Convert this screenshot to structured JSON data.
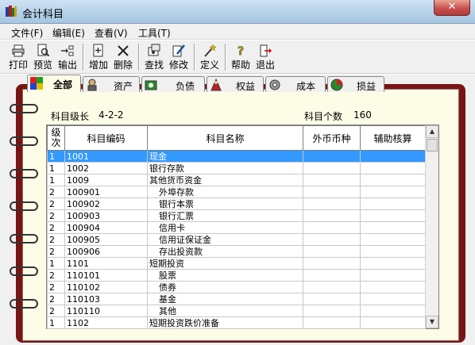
{
  "window": {
    "title": "会计科目",
    "close_label": "✕"
  },
  "menu": [
    "文件(F)",
    "编辑(E)",
    "查看(V)",
    "工具(T)"
  ],
  "toolbar": {
    "print": "打印",
    "preview": "预览",
    "export": "输出",
    "add": "增加",
    "delete": "删除",
    "find": "查找",
    "edit": "修改",
    "define": "定义",
    "help": "帮助",
    "exit": "退出"
  },
  "tabs": [
    "全部",
    "资产",
    "负债",
    "权益",
    "成本",
    "损益"
  ],
  "info": {
    "level_label": "科目级长",
    "level_value": "4-2-2",
    "count_label": "科目个数",
    "count_value": "160"
  },
  "grid": {
    "headers": {
      "level_line1": "级",
      "level_line2": "次",
      "code": "科目编码",
      "name": "科目名称",
      "currency": "外币币种",
      "aux": "辅助核算"
    },
    "rows": [
      {
        "level": "1",
        "code": "1001",
        "name": "现金"
      },
      {
        "level": "1",
        "code": "1002",
        "name": "银行存款"
      },
      {
        "level": "1",
        "code": "1009",
        "name": "其他货币资金"
      },
      {
        "level": "2",
        "code": "100901",
        "name": "外埠存款"
      },
      {
        "level": "2",
        "code": "100902",
        "name": "银行本票"
      },
      {
        "level": "2",
        "code": "100903",
        "name": "银行汇票"
      },
      {
        "level": "2",
        "code": "100904",
        "name": "信用卡"
      },
      {
        "level": "2",
        "code": "100905",
        "name": "信用证保证金"
      },
      {
        "level": "2",
        "code": "100906",
        "name": "存出投资款"
      },
      {
        "level": "1",
        "code": "1101",
        "name": "短期投资"
      },
      {
        "level": "2",
        "code": "110101",
        "name": "股票"
      },
      {
        "level": "2",
        "code": "110102",
        "name": "债券"
      },
      {
        "level": "2",
        "code": "110103",
        "name": "基金"
      },
      {
        "level": "2",
        "code": "110110",
        "name": "其他"
      },
      {
        "level": "1",
        "code": "1102",
        "name": "短期投资跌价准备"
      }
    ]
  }
}
